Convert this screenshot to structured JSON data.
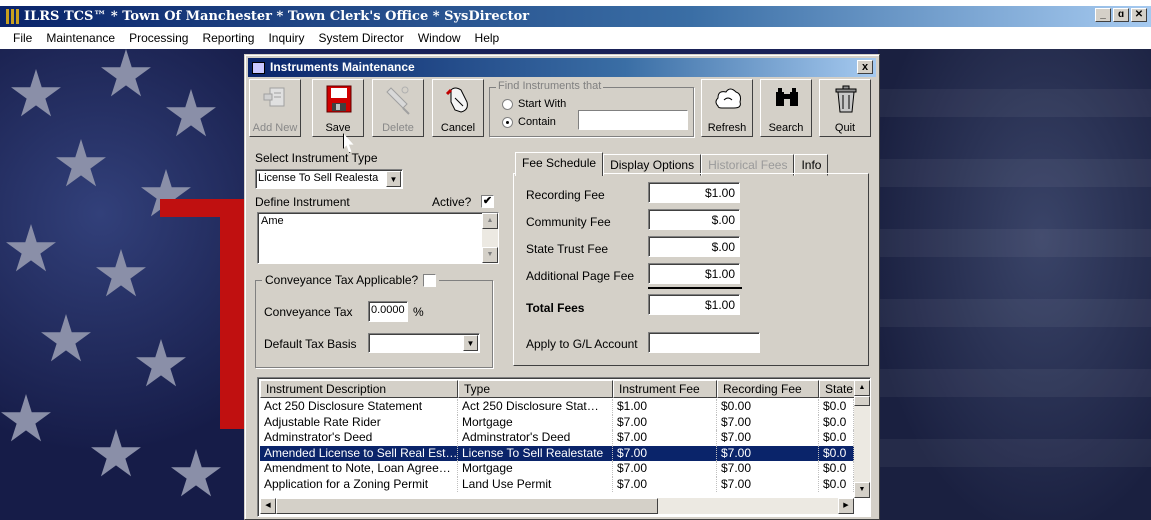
{
  "app": {
    "title": "ILRS TCS™ * Town Of Manchester * Town Clerk's Office * SysDirector",
    "window_buttons": [
      "_",
      "ɑ",
      "✕"
    ]
  },
  "menu": [
    "File",
    "Maintenance",
    "Processing",
    "Reporting",
    "Inquiry",
    "System Director",
    "Window",
    "Help"
  ],
  "dialog": {
    "title": "Instruments Maintenance",
    "close": "x",
    "toolbar": {
      "add_new": "Add New",
      "save": "Save",
      "delete": "Delete",
      "cancel": "Cancel",
      "refresh": "Refresh",
      "search": "Search",
      "quit": "Quit"
    },
    "find": {
      "legend": "Find Instruments that",
      "start_with": "Start With",
      "contain": "Contain",
      "selected": "Contain",
      "value": ""
    },
    "instrument_type_label": "Select Instrument Type",
    "instrument_type_value": "License To Sell Realesta",
    "define_label": "Define Instrument",
    "active_label": "Active?",
    "active_checked": "✔",
    "define_value": "Ame",
    "conveyance": {
      "legend": "Conveyance Tax Applicable?",
      "tax_label": "Conveyance Tax",
      "tax_value": "0.0000",
      "tax_unit": "%",
      "basis_label": "Default Tax Basis",
      "basis_value": ""
    },
    "tabs": [
      "Fee Schedule",
      "Display Options",
      "Historical Fees",
      "Info"
    ],
    "fees": {
      "recording_label": "Recording Fee",
      "recording_value": "$1.00",
      "community_label": "Community Fee",
      "community_value": "$.00",
      "state_label": "State Trust Fee",
      "state_value": "$.00",
      "additional_label": "Additional Page Fee",
      "additional_value": "$1.00",
      "total_label": "Total Fees",
      "total_value": "$1.00",
      "gl_label": "Apply to G/L Account",
      "gl_value": ""
    },
    "grid": {
      "headers": [
        "Instrument Description",
        "Type",
        "Instrument Fee",
        "Recording Fee",
        "State"
      ],
      "rows": [
        [
          "Act 250 Disclosure Statement",
          "Act 250 Disclosure Stat…",
          "$1.00",
          "$0.00",
          "$0.0"
        ],
        [
          "Adjustable Rate Rider",
          "Mortgage",
          "$7.00",
          "$7.00",
          "$0.0"
        ],
        [
          "Adminstrator's Deed",
          "Adminstrator's Deed",
          "$7.00",
          "$7.00",
          "$0.0"
        ],
        [
          "Amended License to Sell Real Est…",
          "License To Sell Realestate",
          "$7.00",
          "$7.00",
          "$0.0"
        ],
        [
          "Amendment to Note, Loan Agree…",
          "Mortgage",
          "$7.00",
          "$7.00",
          "$0.0"
        ],
        [
          "Application for a Zoning Permit",
          "Land Use Permit",
          "$7.00",
          "$7.00",
          "$0.0"
        ]
      ],
      "selected_row": 3
    }
  }
}
